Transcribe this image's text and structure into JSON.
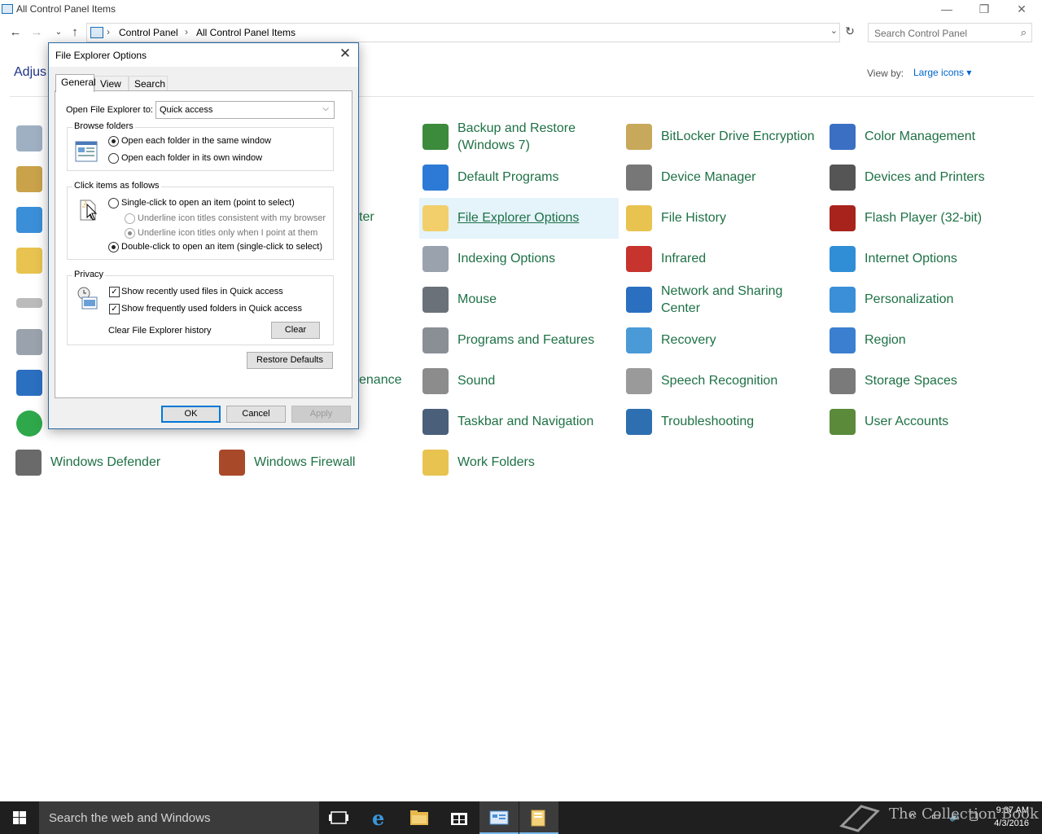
{
  "window": {
    "title": "All Control Panel Items",
    "minimize": "—",
    "restore": "❐",
    "close": "✕"
  },
  "addressbar": {
    "crumbs": [
      "Control Panel",
      "All Control Panel Items"
    ],
    "search_placeholder": "Search Control Panel"
  },
  "main": {
    "heading_partial": "Adjus",
    "view_by_label": "View by:",
    "view_by_value": "Large icons ▾"
  },
  "items": [
    {
      "label": "Backup and Restore (Windows 7)",
      "color": "#3c8a3c",
      "icon": "backup-icon"
    },
    {
      "label": "BitLocker Drive Encryption",
      "color": "#c8a85a",
      "icon": "bitlocker-key-icon"
    },
    {
      "label": "Color Management",
      "color": "#3a6fc4",
      "icon": "color-management-icon"
    },
    {
      "label": "Default Programs",
      "color": "#2c7ad6",
      "icon": "default-programs-icon"
    },
    {
      "label": "Device Manager",
      "color": "#777777",
      "icon": "device-manager-icon"
    },
    {
      "label": "Devices and Printers",
      "color": "#555555",
      "icon": "printer-icon"
    },
    {
      "label": "File Explorer Options",
      "color": "#f2cf6a",
      "icon": "folder-options-icon"
    },
    {
      "label": "File History",
      "color": "#e8c350",
      "icon": "file-history-icon"
    },
    {
      "label": "Flash Player (32-bit)",
      "color": "#a8231c",
      "icon": "flash-icon"
    },
    {
      "label": "Indexing Options",
      "color": "#9aa2ad",
      "icon": "indexing-icon"
    },
    {
      "label": "Infrared",
      "color": "#c7332d",
      "icon": "infrared-icon"
    },
    {
      "label": "Internet Options",
      "color": "#2f8ed6",
      "icon": "internet-options-icon"
    },
    {
      "label": "Mouse",
      "color": "#6b7178",
      "icon": "mouse-icon"
    },
    {
      "label": "Network and Sharing Center",
      "color": "#2b6fc0",
      "icon": "network-icon"
    },
    {
      "label": "Personalization",
      "color": "#3a8fd8",
      "icon": "personalization-icon"
    },
    {
      "label": "Programs and Features",
      "color": "#8a8f96",
      "icon": "programs-icon"
    },
    {
      "label": "Recovery",
      "color": "#4a9ad8",
      "icon": "recovery-icon"
    },
    {
      "label": "Region",
      "color": "#3b7fd0",
      "icon": "region-icon"
    },
    {
      "label": "Sound",
      "color": "#8c8c8c",
      "icon": "sound-icon"
    },
    {
      "label": "Speech Recognition",
      "color": "#9a9a9a",
      "icon": "microphone-icon"
    },
    {
      "label": "Storage Spaces",
      "color": "#7a7a7a",
      "icon": "storage-icon"
    },
    {
      "label": "Taskbar and Navigation",
      "color": "#4a5f7a",
      "icon": "taskbar-icon"
    },
    {
      "label": "Troubleshooting",
      "color": "#2d6fb0",
      "icon": "troubleshooting-icon"
    },
    {
      "label": "User Accounts",
      "color": "#5a8a3a",
      "icon": "users-icon"
    },
    {
      "label": "Windows Defender",
      "color": "#6a6a6a",
      "icon": "defender-icon"
    },
    {
      "label": "Windows Firewall",
      "color": "#a84a2a",
      "icon": "firewall-icon"
    },
    {
      "label": "Work Folders",
      "color": "#e8c350",
      "icon": "work-folders-icon"
    }
  ],
  "partial_items": {
    "ter": "ter",
    "enance": "enance"
  },
  "dialog": {
    "title": "File Explorer Options",
    "tabs": [
      "General",
      "View",
      "Search"
    ],
    "open_to_label": "Open File Explorer to:",
    "open_to_value": "Quick access",
    "browse_group": "Browse folders",
    "browse_same": "Open each folder in the same window",
    "browse_own": "Open each folder in its own window",
    "click_group": "Click items as follows",
    "single_click": "Single-click to open an item (point to select)",
    "underline_browser": "Underline icon titles consistent with my browser",
    "underline_point": "Underline icon titles only when I point at them",
    "double_click": "Double-click to open an item (single-click to select)",
    "privacy_group": "Privacy",
    "recent_files": "Show recently used files in Quick access",
    "frequent_folders": "Show frequently used folders in Quick access",
    "clear_history_label": "Clear File Explorer history",
    "clear_button": "Clear",
    "restore_defaults": "Restore Defaults",
    "ok": "OK",
    "cancel": "Cancel",
    "apply": "Apply"
  },
  "taskbar": {
    "search_placeholder": "Search the web and Windows",
    "time": "9:37 AM",
    "date": "4/3/2016",
    "watermark": "The Collection Book"
  }
}
